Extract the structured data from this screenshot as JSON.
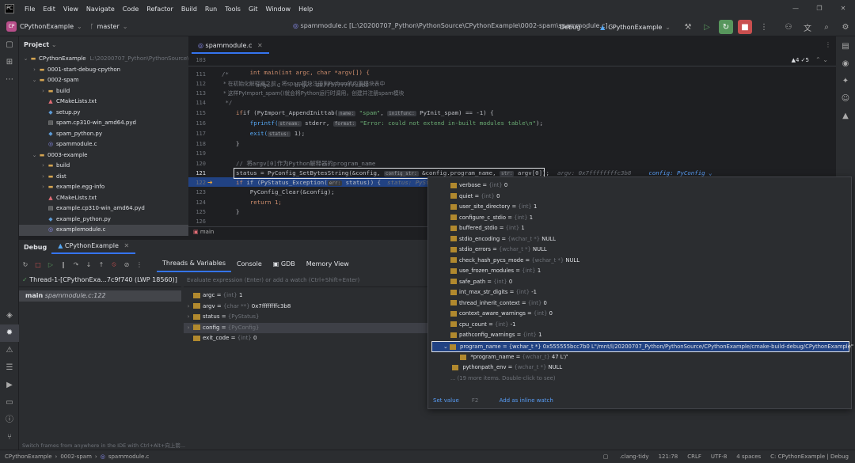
{
  "menubar": {
    "items": [
      "File",
      "Edit",
      "View",
      "Navigate",
      "Code",
      "Refactor",
      "Build",
      "Run",
      "Tools",
      "Git",
      "Window",
      "Help"
    ]
  },
  "toolbar": {
    "project_badge": "CP",
    "project_name": "CPythonExample",
    "branch": "master",
    "file_path": "spammodule.c [L:\\20200707_Python\\PythonSource\\CPythonExample\\0002-spam\\spammodule.c]",
    "build_config": "Debug",
    "run_config": "CPythonExample"
  },
  "project": {
    "title": "Project",
    "tree": [
      {
        "indent": 0,
        "arrow": "⌄",
        "icon": "folder",
        "label": "CPythonExample",
        "note": "L:\\20200707_Python\\PythonSource\\CPythonExample"
      },
      {
        "indent": 1,
        "arrow": "›",
        "icon": "folder",
        "label": "0001-start-debug-cpython"
      },
      {
        "indent": 1,
        "arrow": "⌄",
        "icon": "folder",
        "label": "0002-spam"
      },
      {
        "indent": 2,
        "arrow": "›",
        "icon": "folder",
        "label": "build"
      },
      {
        "indent": 2,
        "arrow": "",
        "icon": "cm",
        "label": "CMakeLists.txt"
      },
      {
        "indent": 2,
        "arrow": "",
        "icon": "py",
        "label": "setup.py"
      },
      {
        "indent": 2,
        "arrow": "",
        "icon": "pyd",
        "label": "spam.cp310-win_amd64.pyd"
      },
      {
        "indent": 2,
        "arrow": "",
        "icon": "py",
        "label": "spam_python.py"
      },
      {
        "indent": 2,
        "arrow": "",
        "icon": "c",
        "label": "spammodule.c"
      },
      {
        "indent": 1,
        "arrow": "⌄",
        "icon": "folder",
        "label": "0003-example"
      },
      {
        "indent": 2,
        "arrow": "›",
        "icon": "folder",
        "label": "build"
      },
      {
        "indent": 2,
        "arrow": "›",
        "icon": "folder",
        "label": "dist"
      },
      {
        "indent": 2,
        "arrow": "›",
        "icon": "folder",
        "label": "example.egg-info"
      },
      {
        "indent": 2,
        "arrow": "",
        "icon": "cm",
        "label": "CMakeLists.txt"
      },
      {
        "indent": 2,
        "arrow": "",
        "icon": "pyd",
        "label": "example.cp310-win_amd64.pyd"
      },
      {
        "indent": 2,
        "arrow": "",
        "icon": "py",
        "label": "example_python.py"
      },
      {
        "indent": 2,
        "arrow": "",
        "icon": "c",
        "label": "examplemodule.c",
        "selected": true
      }
    ]
  },
  "editor": {
    "tab": "spammodule.c",
    "sticky_line": "103",
    "sticky_code": "int main(int argc, char *argv[]) {",
    "sticky_inline": "argc: 1    argv: 0x7ffffffffc3b8",
    "warnings": "▲4  ✓5",
    "lines": [
      "111",
      "112",
      "113",
      "114",
      "115",
      "116",
      "117",
      "118",
      "119",
      "120",
      "121",
      "122",
      "123",
      "124",
      "125",
      "126"
    ],
    "breadcrumb": "main"
  },
  "code": {
    "l1": "/*",
    "l2": " * 在初始化解释器之前，将spam模块注册到Python的内置模块表中",
    "l3": " * 这样PyImport_spam()就会将Python运行时调用，创建并注册spam模块",
    "l4": " */",
    "l5a": "if (PyImport_AppendInittab(",
    "l5h1": "name:",
    "l5s": "\"spam\"",
    "l5h2": "initfunc:",
    "l5b": "PyInit_spam) == -1) {",
    "l6a": "    fprintf(",
    "l6h1": "stream:",
    "l6b": "stderr,",
    "l6h2": "format:",
    "l6s": "\"Error: could not extend in-built modules table\\n\"",
    "l6c": ");",
    "l7a": "    exit(",
    "l7h": "status:",
    "l7b": "1);",
    "l8": "}",
    "l10": "// 将argv[0]作为Python解释器的program_name",
    "l11a": "status = PyConfig_SetBytesString(&config,",
    "l11h1": "config_str:",
    "l11b": "&config.program_name,",
    "l11h2": "str:",
    "l11c": "argv[0]);",
    "l11i1": "argv: 0x7ffffffffc3b8",
    "l11i2": "config: PyConfig ⌄",
    "l12a": "if (PyStatus_Exception(",
    "l12h": "err:",
    "l12b": "status)) {",
    "l12i": "status: PyStat",
    "l13": "    PyConfig_Clear(&config);",
    "l14": "    return 1;",
    "l15": "}"
  },
  "debug": {
    "title": "Debug",
    "config_tab": "CPythonExample",
    "subtabs": [
      "Threads & Variables",
      "Console",
      "GDB",
      "Memory View"
    ],
    "thread": "Thread-1-[CPythonExa...7c9f740 (LWP 18560)]",
    "frame_name": "main",
    "frame_loc": "spammodule.c:122",
    "frames_hint": "Switch frames from anywhere in the IDE with Ctrl+Alt+向上箭...",
    "eval_placeholder": "Evaluate expression (Enter) or add a watch (Ctrl+Shift+Enter)",
    "variables": [
      {
        "arrow": "",
        "name": "argc",
        "type": "{int}",
        "value": "1"
      },
      {
        "arrow": "›",
        "name": "argv",
        "type": "{char **}",
        "value": "0x7ffffffffc3b8"
      },
      {
        "arrow": "›",
        "name": "status",
        "type": "{PyStatus}",
        "value": ""
      },
      {
        "arrow": "›",
        "name": "config",
        "type": "{PyConfig}",
        "value": "",
        "selected": true
      },
      {
        "arrow": "",
        "name": "exit_code",
        "type": "{int}",
        "value": "0"
      }
    ]
  },
  "popup": {
    "rows": [
      {
        "name": "verbose",
        "type": "{int}",
        "value": "0"
      },
      {
        "name": "quiet",
        "type": "{int}",
        "value": "0"
      },
      {
        "name": "user_site_directory",
        "type": "{int}",
        "value": "1"
      },
      {
        "name": "configure_c_stdio",
        "type": "{int}",
        "value": "1"
      },
      {
        "name": "buffered_stdio",
        "type": "{int}",
        "value": "1"
      },
      {
        "name": "stdio_encoding",
        "type": "{wchar_t *}",
        "value": "NULL"
      },
      {
        "name": "stdio_errors",
        "type": "{wchar_t *}",
        "value": "NULL"
      },
      {
        "name": "check_hash_pycs_mode",
        "type": "{wchar_t *}",
        "value": "NULL"
      },
      {
        "name": "use_frozen_modules",
        "type": "{int}",
        "value": "1"
      },
      {
        "name": "safe_path",
        "type": "{int}",
        "value": "0"
      },
      {
        "name": "int_max_str_digits",
        "type": "{int}",
        "value": "-1"
      },
      {
        "name": "thread_inherit_context",
        "type": "{int}",
        "value": "0"
      },
      {
        "name": "context_aware_warnings",
        "type": "{int}",
        "value": "0"
      },
      {
        "name": "cpu_count",
        "type": "{int}",
        "value": "-1"
      },
      {
        "name": "pathconfig_warnings",
        "type": "{int}",
        "value": "1"
      }
    ],
    "selected": "program_name = {wchar_t *} 0x555555bcc7b0 L\"/mnt/l/20200707_Python/PythonSource/CPythonExample/cmake-build-debug/CPythonExample\"",
    "child_name": "*program_name",
    "child_type": "{wchar_t}",
    "child_value": "47 L'/'",
    "after_name": "pythonpath_env",
    "after_type": "{wchar_t *}",
    "after_value": "NULL",
    "more": "... (19 more items. Double-click to see)",
    "set_value": "Set value",
    "set_value_key": "F2",
    "add_inline": "Add as inline watch"
  },
  "statusbar": {
    "crumbs": [
      "CPythonExample",
      "›",
      "0002-spam",
      "›",
      "spammodule.c"
    ],
    "right": [
      ".clang-tidy",
      "121:78",
      "CRLF",
      "UTF-8",
      "4 spaces",
      "C: CPythonExample | Debug"
    ]
  }
}
